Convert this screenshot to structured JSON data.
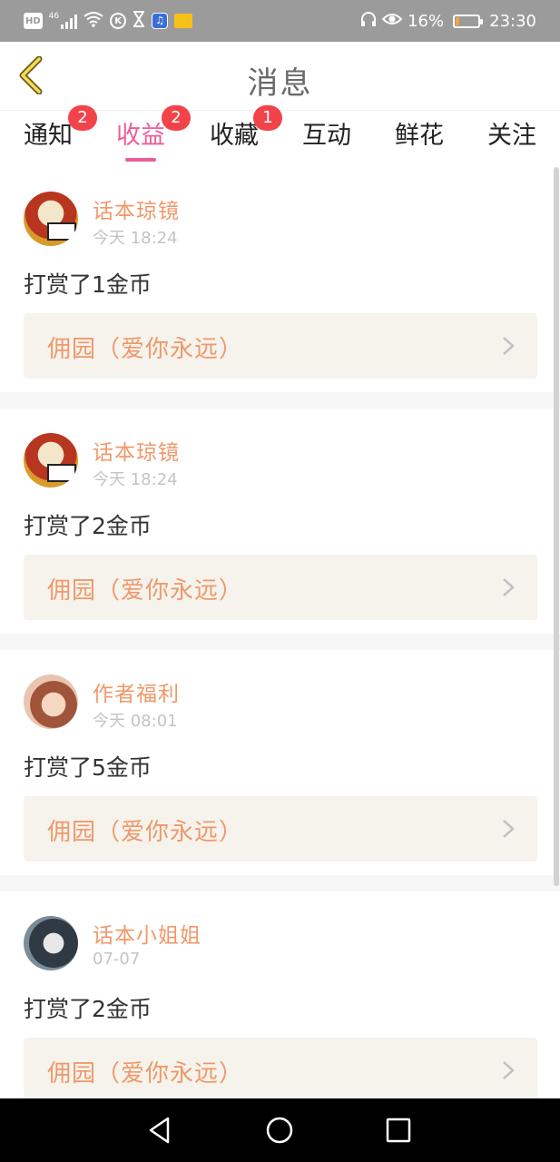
{
  "status_bar": {
    "hd": "HD",
    "network": "46",
    "battery_percent": "16%",
    "battery_level": 0.16,
    "time": "23:30",
    "icons": [
      "hd-icon",
      "signal-icon",
      "wifi-icon",
      "k-app-icon",
      "hourglass-icon",
      "music-app-icon",
      "app-icon",
      "headphones-icon",
      "eye-icon",
      "battery-icon"
    ]
  },
  "header": {
    "title": "消息"
  },
  "tabs": [
    {
      "label": "通知",
      "badge": "2",
      "active": false
    },
    {
      "label": "收益",
      "badge": "2",
      "active": true
    },
    {
      "label": "收藏",
      "badge": "1",
      "active": false
    },
    {
      "label": "互动",
      "badge": "",
      "active": false
    },
    {
      "label": "鲜花",
      "badge": "",
      "active": false
    },
    {
      "label": "关注",
      "badge": "",
      "active": false
    }
  ],
  "messages": [
    {
      "sender": "话本琼镜",
      "time": "今天 18:24",
      "text": "打赏了1金币",
      "book": "佣园（爱你永远）"
    },
    {
      "sender": "话本琼镜",
      "time": "今天 18:24",
      "text": "打赏了2金币",
      "book": "佣园（爱你永远）"
    },
    {
      "sender": "作者福利",
      "time": "今天 08:01",
      "text": "打赏了5金币",
      "book": "佣园（爱你永远）"
    },
    {
      "sender": "话本小姐姐",
      "time": "07-07",
      "text": "打赏了2金币",
      "book": "佣园（爱你永远）"
    }
  ],
  "colors": {
    "accent": "#ea5e98",
    "sender": "#f0986a",
    "badge": "#f2434a",
    "status_bar": "#9b9b9b"
  }
}
